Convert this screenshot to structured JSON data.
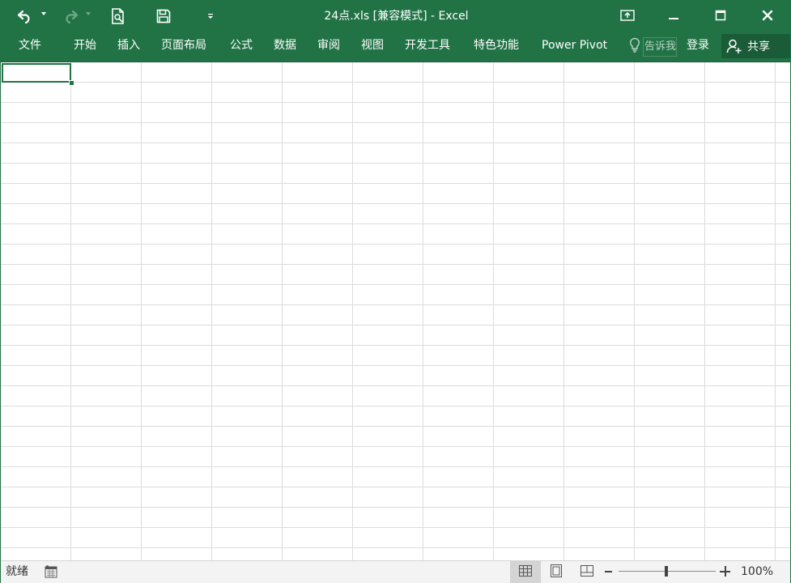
{
  "window": {
    "title": "24点.xls  [兼容模式] - Excel"
  },
  "quick_access": {
    "undo": "undo-icon",
    "redo": "redo-icon",
    "print_preview": "print-preview-icon",
    "save": "save-icon",
    "customize": "customize-qat-icon"
  },
  "ribbon": {
    "tabs": [
      {
        "label": "文件"
      },
      {
        "label": "开始"
      },
      {
        "label": "插入"
      },
      {
        "label": "页面布局"
      },
      {
        "label": "公式"
      },
      {
        "label": "数据"
      },
      {
        "label": "审阅"
      },
      {
        "label": "视图"
      },
      {
        "label": "开发工具"
      },
      {
        "label": "特色功能"
      },
      {
        "label": "Power Pivot"
      }
    ],
    "tell_me": {
      "icon": "lightbulb-icon",
      "placeholder": "告诉我"
    },
    "login_label": "登录",
    "share_label": "共享"
  },
  "statusbar": {
    "status": "就绪",
    "macro_icon": "macro-record-icon",
    "zoom_level": "100%",
    "zoom_percent": 100
  },
  "colors": {
    "accent": "#217346",
    "grid_line": "#dadcdd",
    "status_bg": "#f3f3f3"
  }
}
